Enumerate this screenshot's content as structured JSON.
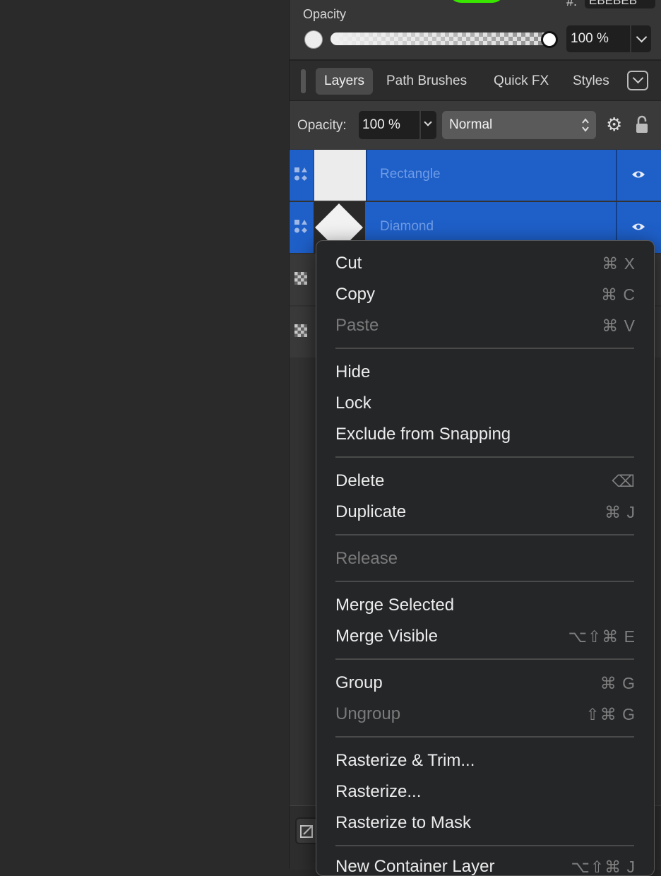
{
  "color_panel": {
    "hex_label": "#:",
    "hex_value": "EBEBEB",
    "opacity_label": "Opacity",
    "opacity_value": "100 %"
  },
  "tabs": [
    {
      "label": "Layers",
      "active": true
    },
    {
      "label": "Path Brushes",
      "active": false
    },
    {
      "label": "Quick FX",
      "active": false
    },
    {
      "label": "Styles",
      "active": false
    }
  ],
  "layer_bar": {
    "opacity_label": "Opacity:",
    "opacity_value": "100 %",
    "blend_mode": "Normal"
  },
  "layers": [
    {
      "name": "Rectangle",
      "selected": true
    },
    {
      "name": "Diamond",
      "selected": true
    },
    {
      "name": "",
      "selected": false
    },
    {
      "name": "",
      "selected": false
    }
  ],
  "context_menu": {
    "items": [
      {
        "label": "Cut",
        "shortcut": "⌘ X",
        "disabled": false
      },
      {
        "label": "Copy",
        "shortcut": "⌘ C",
        "disabled": false
      },
      {
        "label": "Paste",
        "shortcut": "⌘ V",
        "disabled": true
      },
      {
        "label": "Hide",
        "shortcut": "",
        "disabled": false
      },
      {
        "label": "Lock",
        "shortcut": "",
        "disabled": false
      },
      {
        "label": "Exclude from Snapping",
        "shortcut": "",
        "disabled": false
      },
      {
        "label": "Delete",
        "shortcut": "⌫",
        "disabled": false
      },
      {
        "label": "Duplicate",
        "shortcut": "⌘ J",
        "disabled": false
      },
      {
        "label": "Release",
        "shortcut": "",
        "disabled": true
      },
      {
        "label": "Merge Selected",
        "shortcut": "",
        "disabled": false
      },
      {
        "label": "Merge Visible",
        "shortcut": "⌥⇧⌘ E",
        "disabled": false
      },
      {
        "label": "Group",
        "shortcut": "⌘ G",
        "disabled": false
      },
      {
        "label": "Ungroup",
        "shortcut": "⇧⌘ G",
        "disabled": true
      },
      {
        "label": "Rasterize & Trim...",
        "shortcut": "",
        "disabled": false
      },
      {
        "label": "Rasterize...",
        "shortcut": "",
        "disabled": false
      },
      {
        "label": "Rasterize to Mask",
        "shortcut": "",
        "disabled": false
      },
      {
        "label": "New Container Layer",
        "shortcut": "⌥⇧⌘ J",
        "disabled": false
      }
    ]
  },
  "colors": {
    "selection": "#1e5fc8",
    "menu_bg": "#252628",
    "accent_green": "#39e600"
  }
}
